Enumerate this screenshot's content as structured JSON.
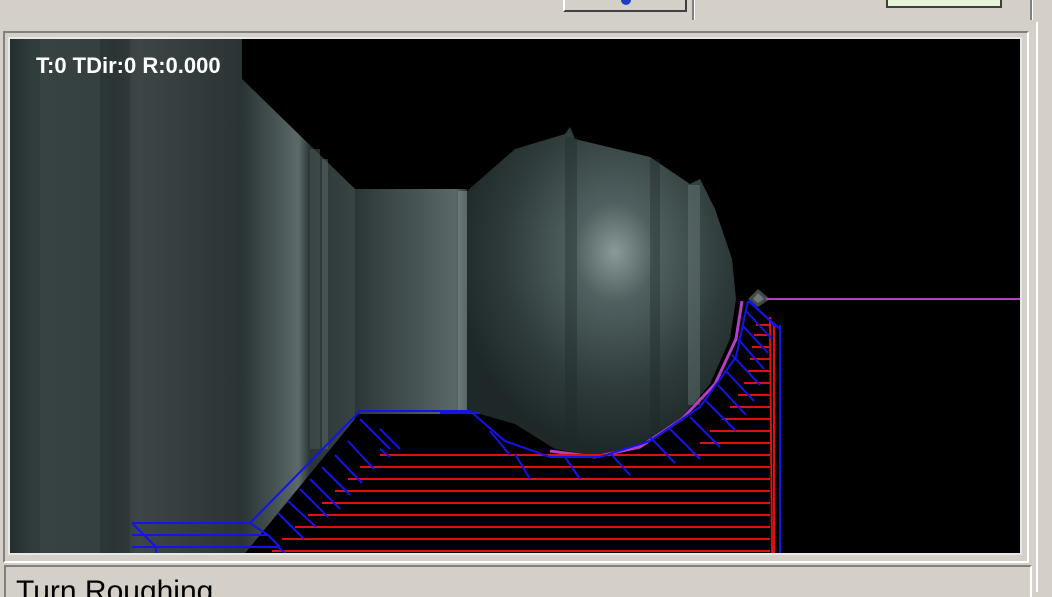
{
  "viewport": {
    "tool_readout": "T:0 TDir:0 R:0.000",
    "colors": {
      "background": "#000000",
      "part_surface": "#3a4444",
      "roughing_passes": "#e01010",
      "tool_retract": "#1010e0",
      "finish_profile": "#b040c0"
    },
    "icons": [
      "cutting-tool-icon"
    ]
  },
  "status_bar": {
    "operation_label": "Turn Roughing"
  }
}
